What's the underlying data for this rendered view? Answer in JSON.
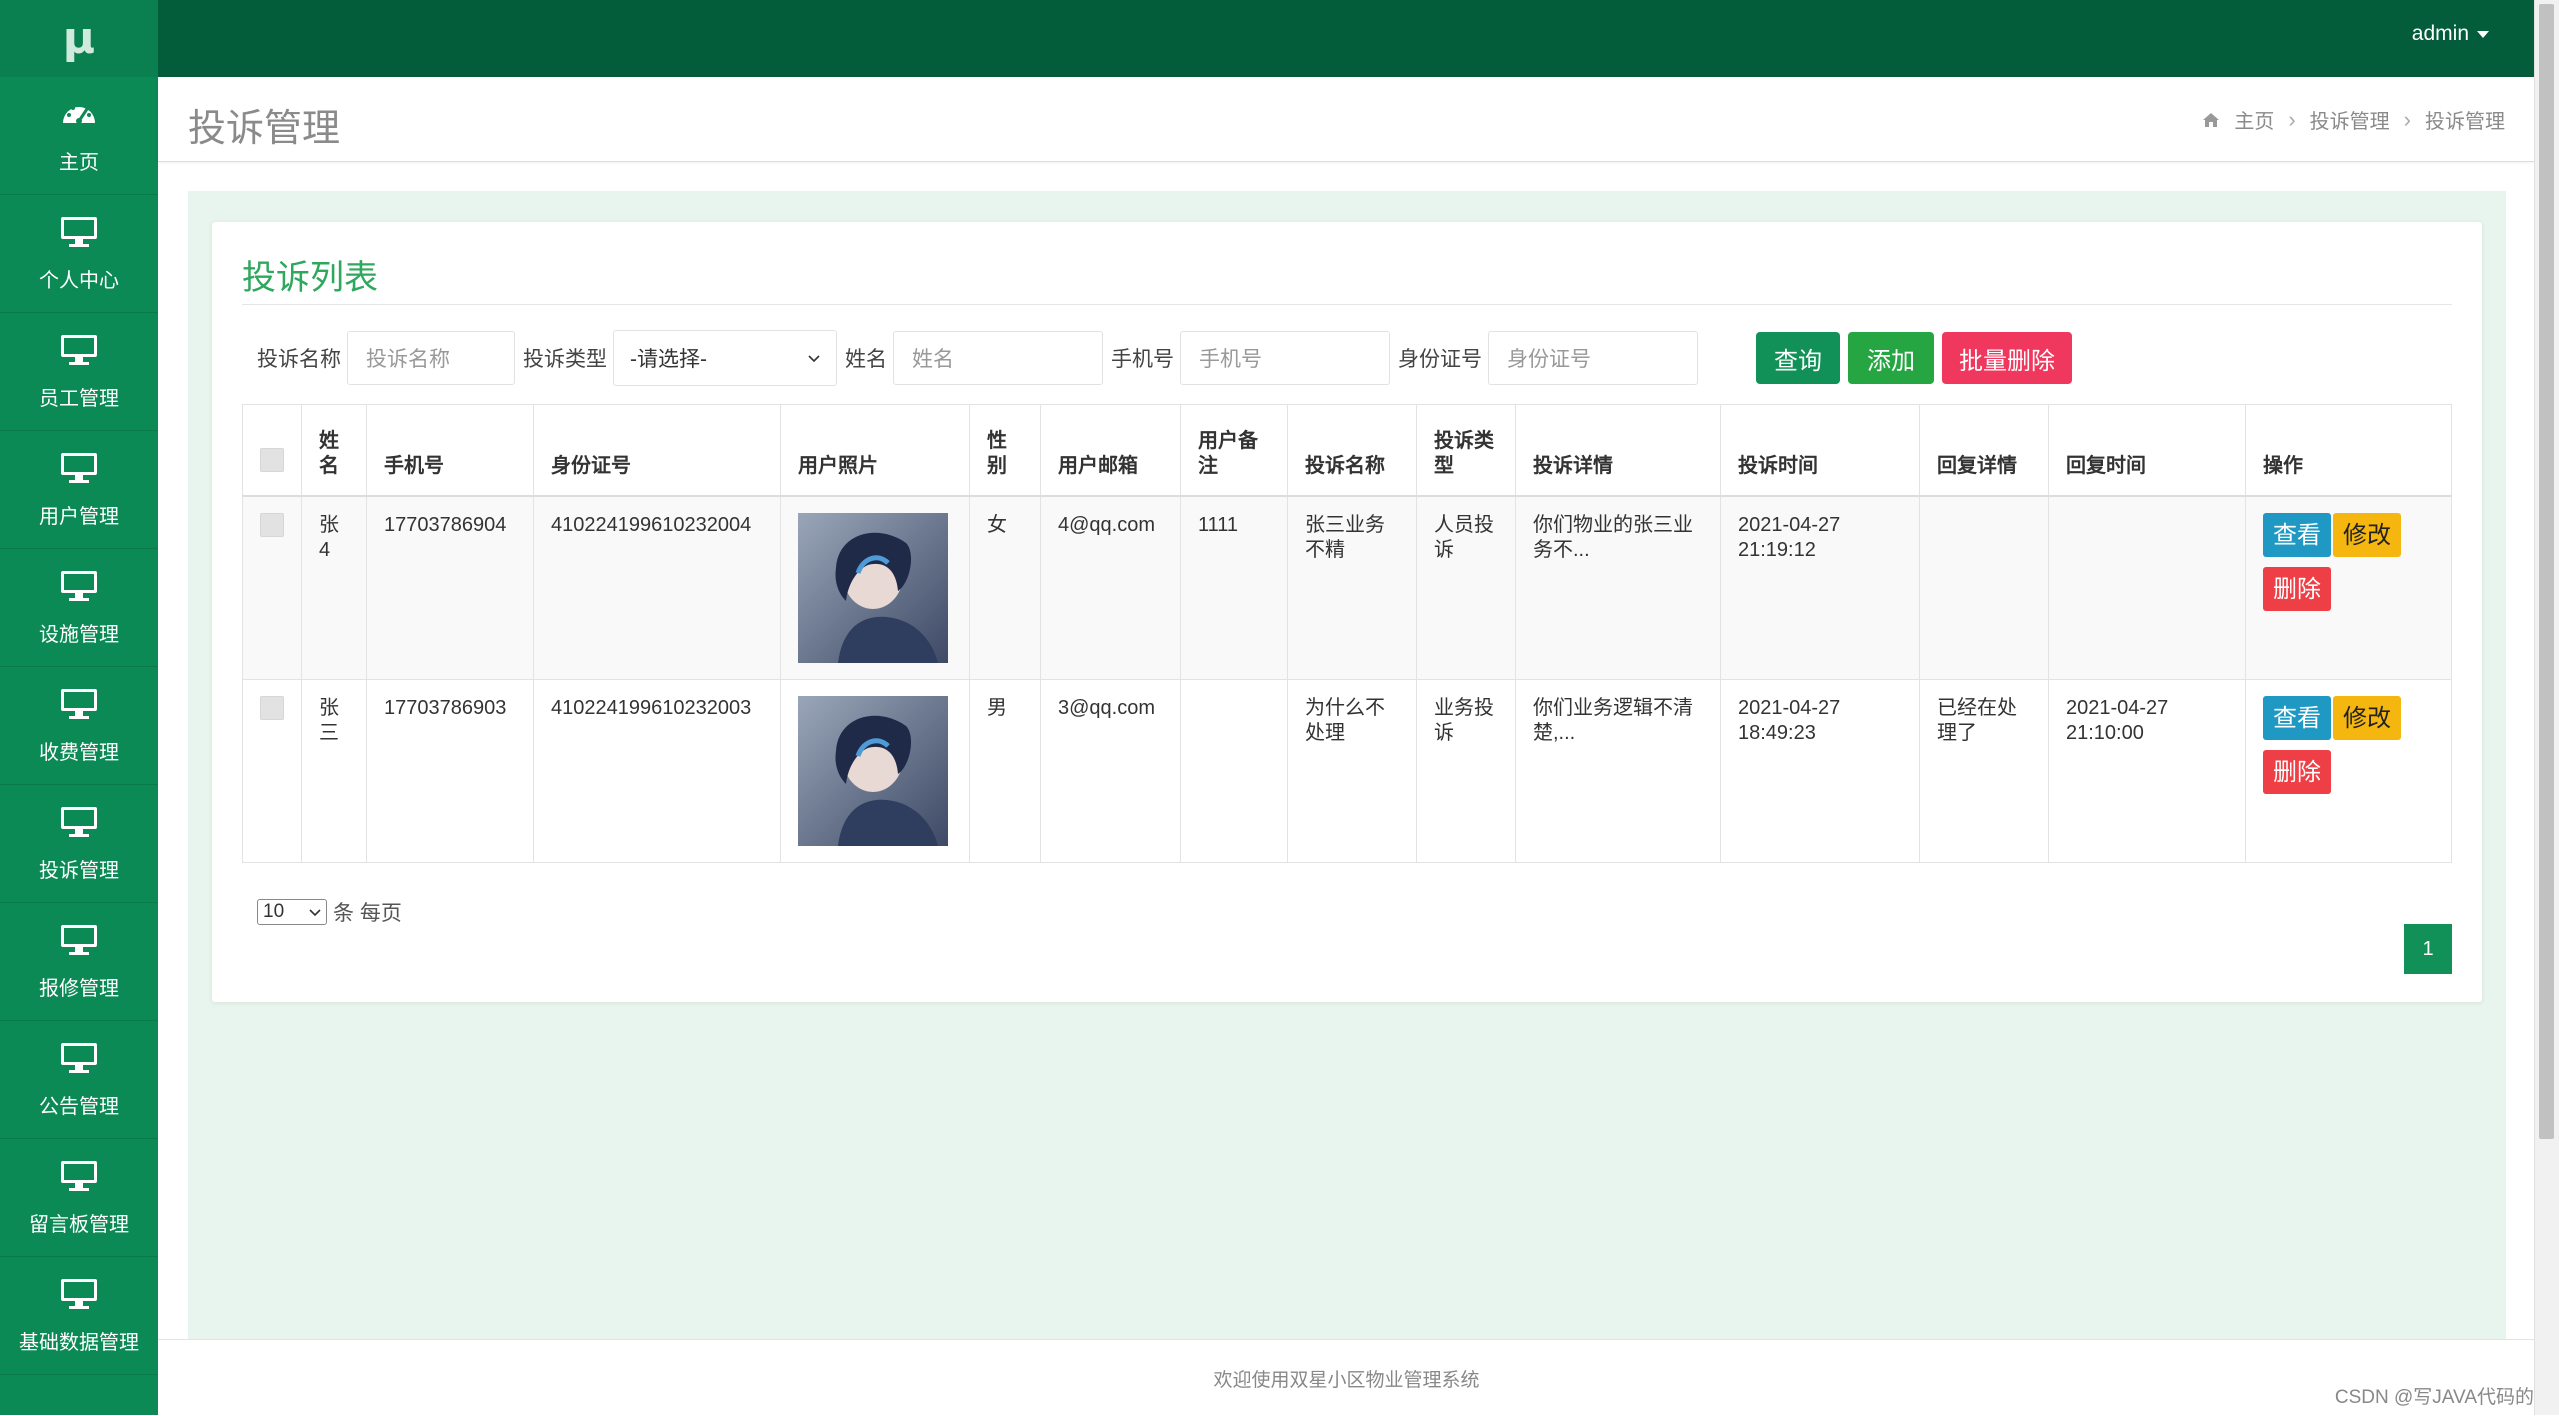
{
  "logo": "μ",
  "sidebar": {
    "items": [
      {
        "label": "主页",
        "icon": "dashboard-icon"
      },
      {
        "label": "个人中心",
        "icon": "monitor-icon"
      },
      {
        "label": "员工管理",
        "icon": "monitor-icon"
      },
      {
        "label": "用户管理",
        "icon": "monitor-icon"
      },
      {
        "label": "设施管理",
        "icon": "monitor-icon"
      },
      {
        "label": "收费管理",
        "icon": "monitor-icon"
      },
      {
        "label": "投诉管理",
        "icon": "monitor-icon"
      },
      {
        "label": "报修管理",
        "icon": "monitor-icon"
      },
      {
        "label": "公告管理",
        "icon": "monitor-icon"
      },
      {
        "label": "留言板管理",
        "icon": "monitor-icon"
      },
      {
        "label": "基础数据管理",
        "icon": "monitor-icon"
      }
    ]
  },
  "topbar": {
    "user": "admin"
  },
  "header": {
    "title": "投诉管理",
    "breadcrumb": [
      "主页",
      "投诉管理",
      "投诉管理"
    ]
  },
  "card": {
    "title": "投诉列表"
  },
  "filters": {
    "name_label": "投诉名称",
    "name_placeholder": "投诉名称",
    "type_label": "投诉类型",
    "type_selected": "-请选择-",
    "person_label": "姓名",
    "person_placeholder": "姓名",
    "phone_label": "手机号",
    "phone_placeholder": "手机号",
    "id_label": "身份证号",
    "id_placeholder": "身份证号",
    "query_btn": "查询",
    "add_btn": "添加",
    "batch_delete_btn": "批量删除"
  },
  "table": {
    "headers": {
      "name": "姓名",
      "phone": "手机号",
      "idno": "身份证号",
      "photo": "用户照片",
      "gender": "性别",
      "email": "用户邮箱",
      "note": "用户备注",
      "title": "投诉名称",
      "type": "投诉类型",
      "detail": "投诉详情",
      "time": "投诉时间",
      "reply": "回复详情",
      "reply_time": "回复时间",
      "ops": "操作"
    },
    "rows": [
      {
        "name": "张4",
        "phone": "17703786904",
        "idno": "410224199610232004",
        "gender": "女",
        "email": "4@qq.com",
        "note": "1111",
        "title": "张三业务不精",
        "type": "人员投诉",
        "detail": "你们物业的张三业务不...",
        "time": "2021-04-27 21:19:12",
        "reply": "",
        "reply_time": ""
      },
      {
        "name": "张三",
        "phone": "17703786903",
        "idno": "410224199610232003",
        "gender": "男",
        "email": "3@qq.com",
        "note": "",
        "title": "为什么不处理",
        "type": "业务投诉",
        "detail": "你们业务逻辑不清楚,...",
        "time": "2021-04-27 18:49:23",
        "reply": "已经在处理了",
        "reply_time": "2021-04-27 21:10:00"
      }
    ],
    "actions": {
      "view": "查看",
      "edit": "修改",
      "delete": "删除"
    }
  },
  "pagination": {
    "page_size": "10",
    "per_page_label": "条 每页",
    "current_page": "1"
  },
  "footer": {
    "text": "欢迎使用双星小区物业管理系统"
  },
  "watermark": "CSDN @写JAVA代码的人"
}
